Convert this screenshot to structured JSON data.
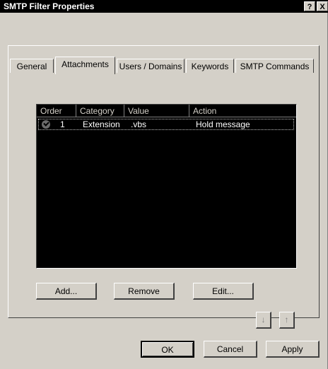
{
  "window": {
    "title": "SMTP Filter Properties",
    "help_label": "?",
    "close_label": "X"
  },
  "tabs": [
    {
      "label": "General"
    },
    {
      "label": "Attachments"
    },
    {
      "label": "Users / Domains"
    },
    {
      "label": "Keywords"
    },
    {
      "label": "SMTP Commands"
    }
  ],
  "active_tab": "Attachments",
  "list": {
    "columns": [
      "Order",
      "Category",
      "Value",
      "Action"
    ],
    "rows": [
      {
        "order": "1",
        "category": "Extension",
        "value": ".vbs",
        "action": "Hold message",
        "status_icon": "check-icon"
      }
    ]
  },
  "buttons": {
    "add": "Add...",
    "remove": "Remove",
    "edit": "Edit...",
    "move_down_icon": "down-arrow-icon",
    "move_up_icon": "up-arrow-icon"
  },
  "footer": {
    "ok": "OK",
    "cancel": "Cancel",
    "apply": "Apply"
  }
}
